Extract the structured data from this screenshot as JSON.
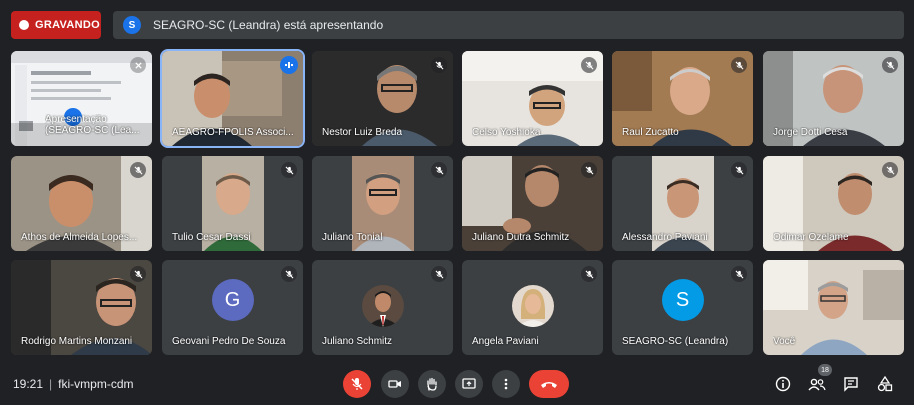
{
  "recording": {
    "label": "GRAVANDO"
  },
  "presentation": {
    "badge": "S",
    "text": "SEAGRO-SC (Leandra) está apresentando"
  },
  "participants": [
    {
      "name": "Apresentação (SEAGRO-SC (Lea...",
      "muted": false,
      "type": "screen"
    },
    {
      "name": "AEAGRO-FPOLIS Associ...",
      "muted": false,
      "speaking": true,
      "type": "video"
    },
    {
      "name": "Nestor Luiz Breda",
      "muted": true,
      "type": "video"
    },
    {
      "name": "Celso Yoshioka",
      "muted": true,
      "type": "video"
    },
    {
      "name": "Raul Zucatto",
      "muted": true,
      "type": "video"
    },
    {
      "name": "Jorge Dotti Cesa",
      "muted": true,
      "type": "video"
    },
    {
      "name": "Athos de Almeida Lopes...",
      "muted": true,
      "type": "video"
    },
    {
      "name": "Tulio Cesar Dassi",
      "muted": true,
      "type": "video"
    },
    {
      "name": "Juliano Tonial",
      "muted": true,
      "type": "video"
    },
    {
      "name": "Juliano Dutra Schmitz",
      "muted": true,
      "type": "video"
    },
    {
      "name": "Alessandro Paviani",
      "muted": true,
      "type": "video"
    },
    {
      "name": "Odimar Ozelame",
      "muted": true,
      "type": "video"
    },
    {
      "name": "Rodrigo Martins Monzani",
      "muted": true,
      "type": "video"
    },
    {
      "name": "Geovani Pedro De Souza",
      "muted": true,
      "type": "avatar",
      "initial": "G",
      "color": "#5c6bc0"
    },
    {
      "name": "Juliano Schmitz",
      "muted": true,
      "type": "photo"
    },
    {
      "name": "Angela Paviani",
      "muted": true,
      "type": "photo"
    },
    {
      "name": "SEAGRO-SC (Leandra)",
      "muted": true,
      "type": "avatar",
      "initial": "S",
      "color": "#039be5"
    },
    {
      "name": "Você",
      "muted": false,
      "type": "video"
    }
  ],
  "footer": {
    "time": "19:21",
    "meeting_code": "fki-vmpm-cdm",
    "participant_count": "18"
  },
  "colors": {
    "accent": "#1a73e8",
    "danger": "#ea4335",
    "tile": "#3c4043",
    "background": "#202124"
  }
}
